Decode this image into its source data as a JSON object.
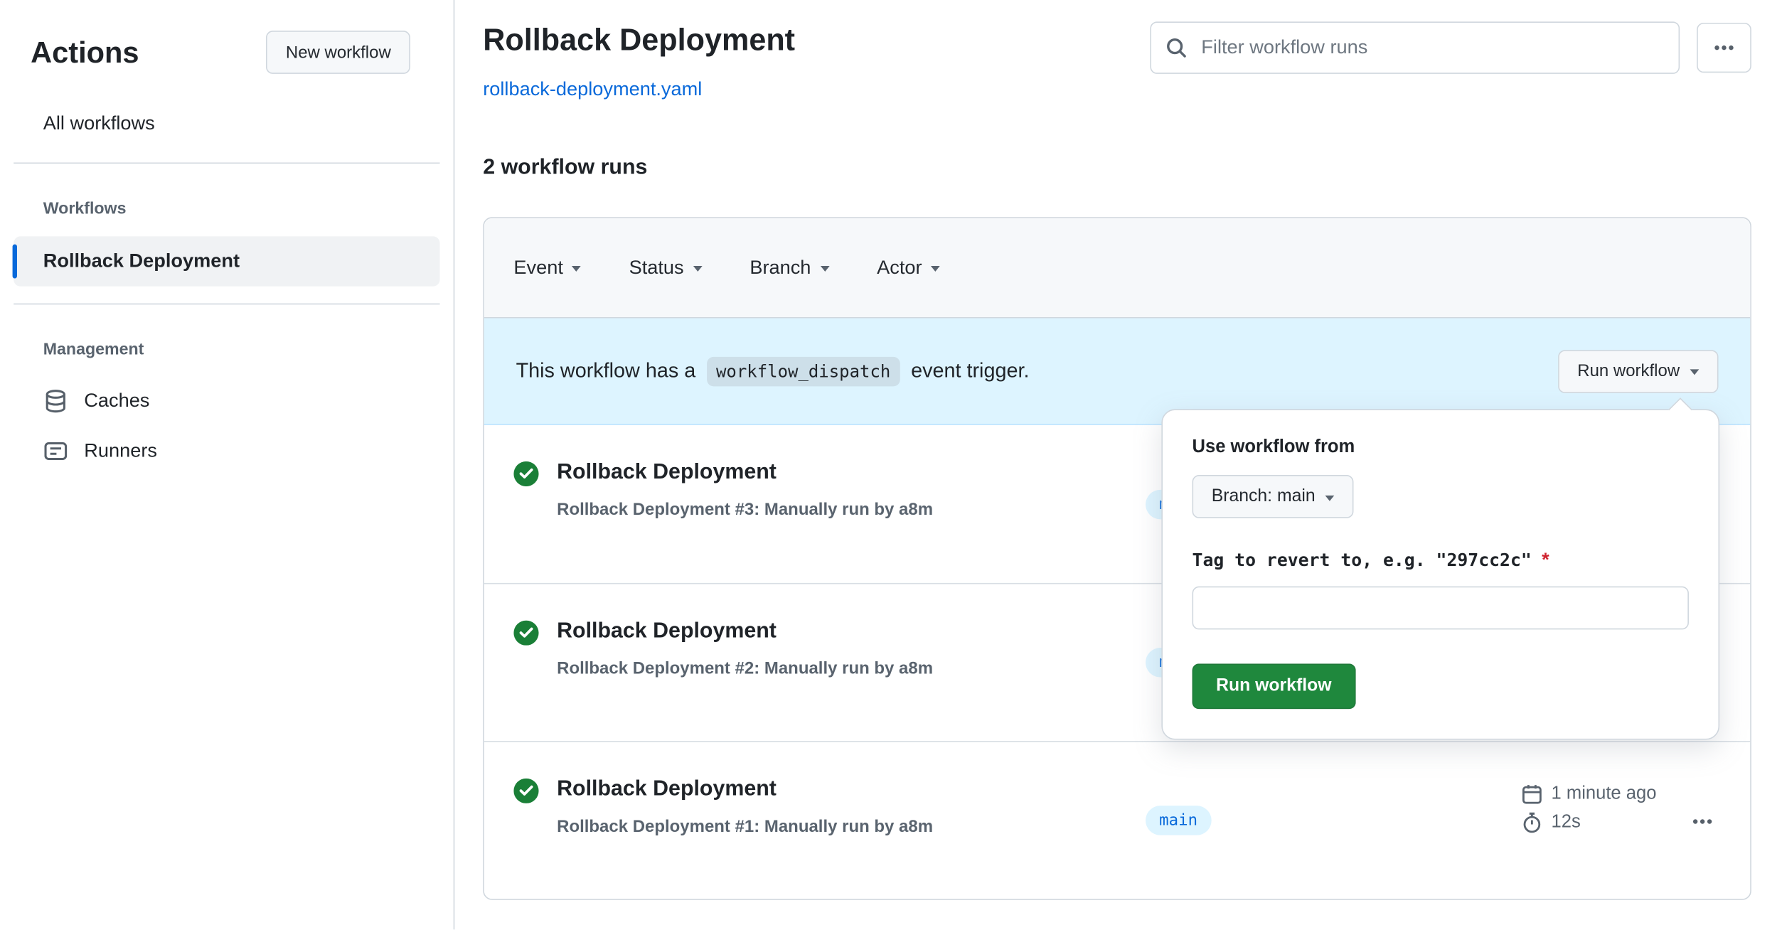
{
  "sidebar": {
    "title": "Actions",
    "new_workflow": "New workflow",
    "all_workflows": "All workflows",
    "workflows_heading": "Workflows",
    "workflow_item": "Rollback Deployment",
    "management_heading": "Management",
    "caches": "Caches",
    "runners": "Runners"
  },
  "header": {
    "title": "Rollback Deployment",
    "file_link": "rollback-deployment.yaml",
    "filter_placeholder": "Filter workflow runs"
  },
  "summary": {
    "runs_count_label": "2 workflow runs"
  },
  "filters": {
    "event": "Event",
    "status": "Status",
    "branch": "Branch",
    "actor": "Actor"
  },
  "banner": {
    "text_before": "This workflow has a",
    "code": "workflow_dispatch",
    "text_after": "event trigger.",
    "run_button": "Run workflow"
  },
  "popover": {
    "heading": "Use workflow from",
    "branch_selector": "Branch: main",
    "tag_label": "Tag to revert to, e.g. \"297cc2c\"",
    "required": "*",
    "tag_value": "",
    "run_button": "Run workflow"
  },
  "runs": [
    {
      "title": "Rollback Deployment",
      "subtitle": "Rollback Deployment #3: Manually run by a8m",
      "branch": "main"
    },
    {
      "title": "Rollback Deployment",
      "subtitle": "Rollback Deployment #2: Manually run by a8m",
      "branch": "main"
    },
    {
      "title": "Rollback Deployment",
      "subtitle": "Rollback Deployment #1: Manually run by a8m",
      "branch": "main",
      "time": "1 minute ago",
      "duration": "12s"
    }
  ],
  "icons": {
    "search": "search-icon",
    "kebab": "kebab-menu-icon",
    "check": "check-circle-icon",
    "cache": "cache-icon",
    "runners": "runners-icon",
    "calendar": "calendar-icon",
    "stopwatch": "stopwatch-icon",
    "chevron": "chevron-down-icon"
  },
  "colors": {
    "accent": "#0969da",
    "success": "#1a7f37",
    "banner_bg": "#ddf4ff",
    "green_button": "#1f883d",
    "required": "#cf222e"
  }
}
